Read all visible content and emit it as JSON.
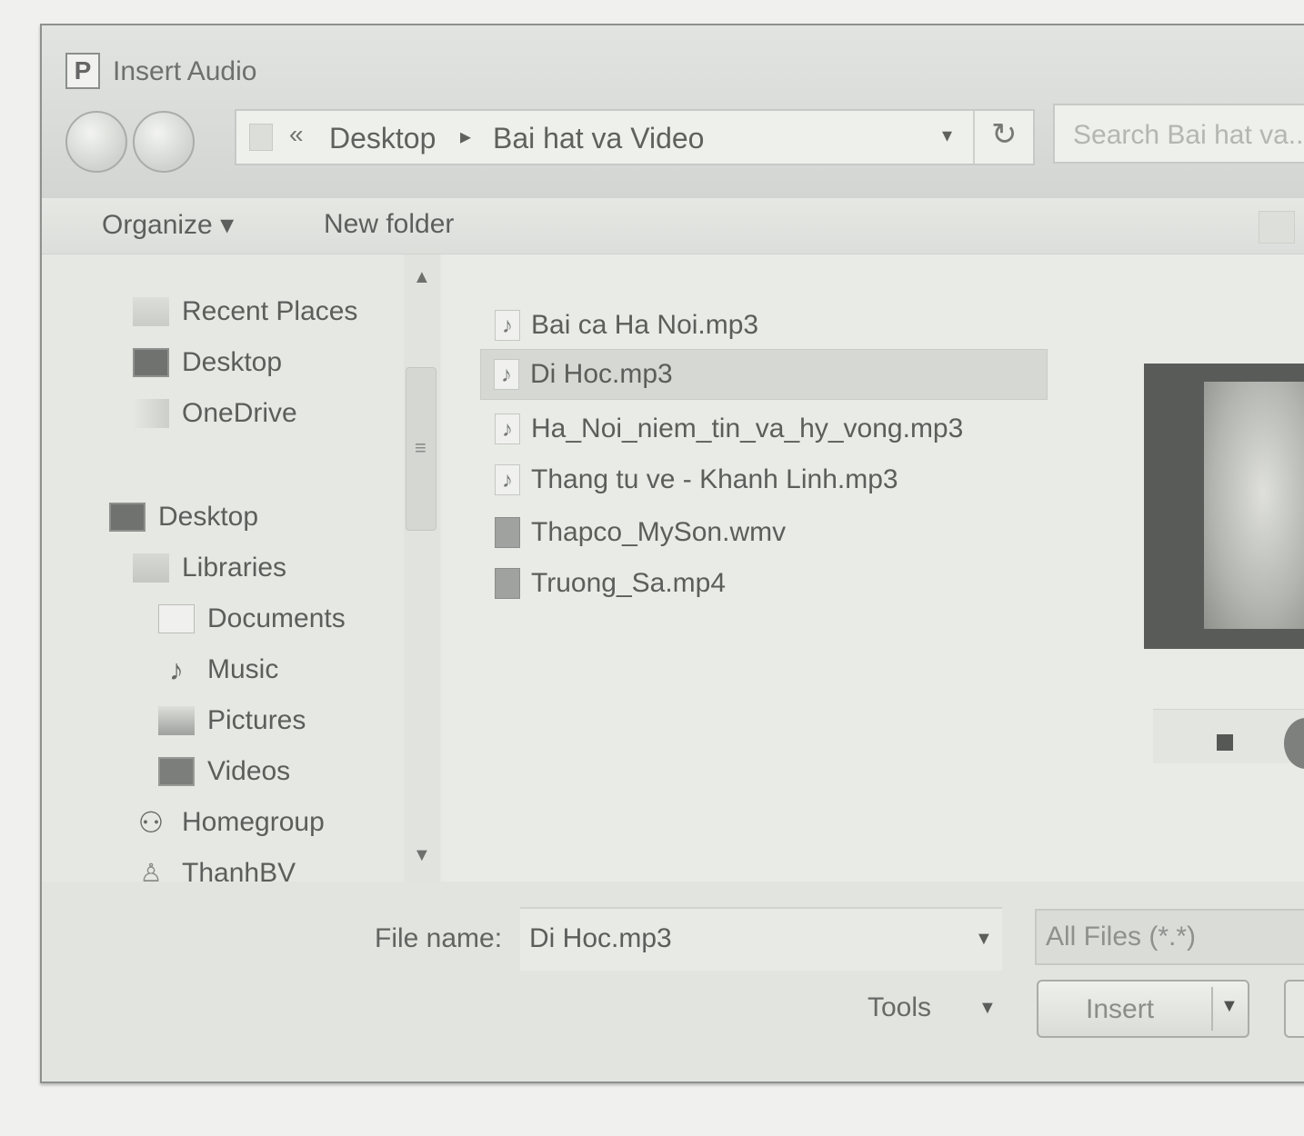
{
  "window": {
    "title": "Insert Audio",
    "app_icon_letter": "P"
  },
  "address_bar": {
    "overflow": "«",
    "segments": [
      "Desktop",
      "Bai hat va Video"
    ],
    "separator": "▸",
    "dropdown": "▾",
    "refresh": "↻"
  },
  "search": {
    "placeholder": "Search Bai hat va..."
  },
  "toolbar": {
    "organize": "Organize ▾",
    "new_folder": "New folder"
  },
  "nav_pane": {
    "items": [
      {
        "label": "Recent Places",
        "icon": "recent-places-icon"
      },
      {
        "label": "Desktop",
        "icon": "desktop-icon"
      },
      {
        "label": "OneDrive",
        "icon": "onedrive-icon"
      },
      {
        "label": "Desktop",
        "icon": "desktop-icon"
      },
      {
        "label": "Libraries",
        "icon": "libraries-icon"
      },
      {
        "label": "Documents",
        "icon": "documents-icon"
      },
      {
        "label": "Music",
        "icon": "music-icon"
      },
      {
        "label": "Pictures",
        "icon": "pictures-icon"
      },
      {
        "label": "Videos",
        "icon": "videos-icon"
      },
      {
        "label": "Homegroup",
        "icon": "homegroup-icon"
      },
      {
        "label": "ThanhBV",
        "icon": "user-icon"
      }
    ]
  },
  "files": [
    {
      "name": "Bai ca Ha Noi.mp3",
      "type": "audio",
      "selected": false
    },
    {
      "name": "Di Hoc.mp3",
      "type": "audio",
      "selected": true
    },
    {
      "name": "Ha_Noi_niem_tin_va_hy_vong.mp3",
      "type": "audio",
      "selected": false
    },
    {
      "name": "Thang tu ve - Khanh Linh.mp3",
      "type": "audio",
      "selected": false
    },
    {
      "name": "Thapco_MySon.wmv",
      "type": "video",
      "selected": false
    },
    {
      "name": "Truong_Sa.mp4",
      "type": "video",
      "selected": false
    }
  ],
  "bottom": {
    "file_name_label": "File name:",
    "file_name_value": "Di Hoc.mp3",
    "file_type": "All Files (*.*)",
    "tools": "Tools",
    "insert": "Insert"
  }
}
